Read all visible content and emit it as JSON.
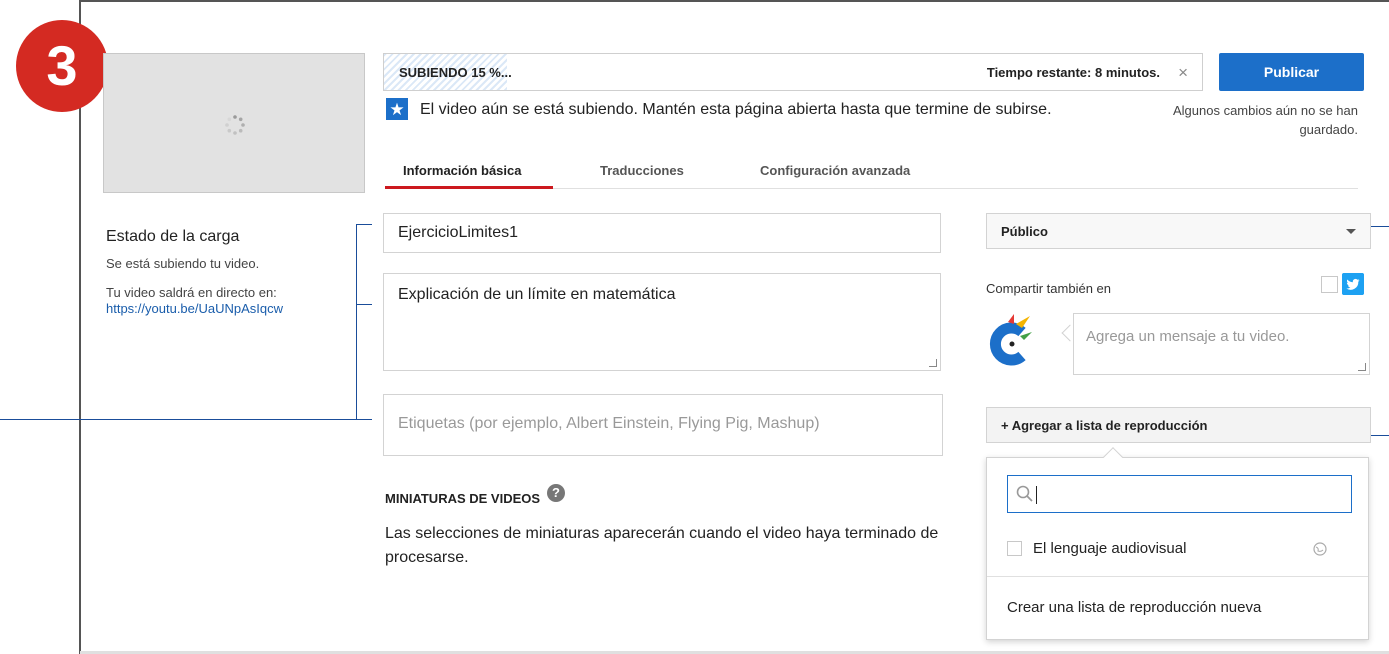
{
  "step": {
    "number": "3"
  },
  "sidebar": {
    "status_title": "Estado de la carga",
    "status_line": "Se está subiendo tu video.",
    "live_label": "Tu video saldrá en directo en:",
    "video_link": "https://youtu.be/UaUNpAsIqcw"
  },
  "upload": {
    "status": "SUBIENDO 15 %...",
    "progress_percent": 15,
    "remaining": "Tiempo restante: 8 minutos.",
    "close": "×",
    "publish_label": "Publicar"
  },
  "notice": {
    "text": "El video aún se está subiendo. Mantén esta página abierta hasta que termine de subirse.",
    "unsaved": "Algunos cambios aún no se han guardado."
  },
  "tabs": [
    {
      "label": "Información básica"
    },
    {
      "label": "Traducciones"
    },
    {
      "label": "Configuración avanzada"
    }
  ],
  "form": {
    "title_value": "EjercicioLimites1",
    "description_value": "Explicación de un límite en matemática",
    "tags_placeholder": "Etiquetas (por ejemplo, Albert Einstein, Flying Pig, Mashup)"
  },
  "privacy": {
    "selected": "Público"
  },
  "share": {
    "label": "Compartir también en",
    "message_placeholder": "Agrega un mensaje a tu video."
  },
  "playlist": {
    "button_label": "+ Agregar a lista de reproducción",
    "search_value": "",
    "items": [
      {
        "label": "El lenguaje audiovisual"
      }
    ],
    "create_label": "Crear una lista de reproducción nueva"
  },
  "thumbnails": {
    "title": "MINIATURAS DE VIDEOS",
    "help": "?",
    "text": "Las selecciones de miniaturas aparecerán cuando el video haya terminado de procesarse."
  },
  "colors": {
    "publish": "#1c6fc9",
    "badge": "#d42a22",
    "tab_active": "#cc181e",
    "annotation": "#1a4d9a"
  }
}
